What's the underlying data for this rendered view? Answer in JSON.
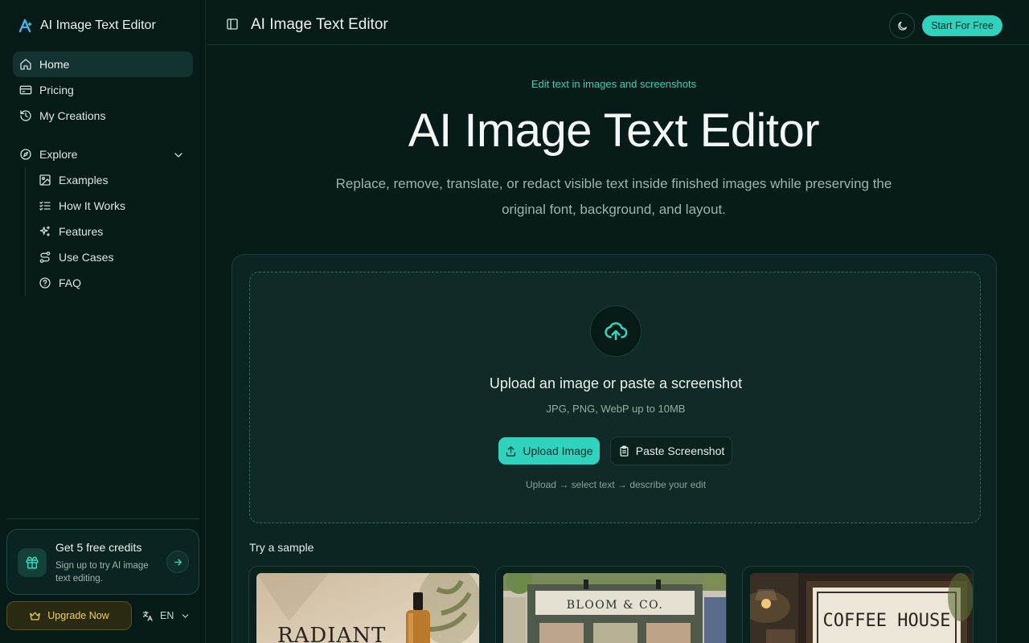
{
  "app": {
    "name": "AI Image Text Editor"
  },
  "sidebar": {
    "nav": [
      {
        "label": "Home",
        "icon": "home-icon",
        "active": true
      },
      {
        "label": "Pricing",
        "icon": "credit-card-icon"
      },
      {
        "label": "My Creations",
        "icon": "history-icon"
      }
    ],
    "explore": {
      "label": "Explore",
      "icon": "compass-icon",
      "items": [
        {
          "label": "Examples",
          "icon": "image-icon"
        },
        {
          "label": "How It Works",
          "icon": "list-checks-icon"
        },
        {
          "label": "Features",
          "icon": "sparkles-icon"
        },
        {
          "label": "Use Cases",
          "icon": "route-icon"
        },
        {
          "label": "FAQ",
          "icon": "help-circle-icon"
        }
      ]
    },
    "credits": {
      "title": "Get 5 free credits",
      "subtitle": "Sign up to try AI image text editing."
    },
    "upgrade_label": "Upgrade Now",
    "language": "EN"
  },
  "header": {
    "title": "AI Image Text Editor",
    "cta_label": "Start For Free"
  },
  "hero": {
    "eyebrow": "Edit text in images and screenshots",
    "title": "AI Image Text Editor",
    "subtitle": "Replace, remove, translate, or redact visible text inside finished images while preserving the original font, background, and layout."
  },
  "upload": {
    "title": "Upload an image or paste a screenshot",
    "formats": "JPG, PNG, WebP up to 10MB",
    "upload_label": "Upload Image",
    "paste_label": "Paste Screenshot",
    "hint": "Upload → select text → describe your edit"
  },
  "samples": {
    "label": "Try a sample",
    "items": [
      {
        "text": "RADIANT"
      },
      {
        "text": "BLOOM & CO."
      },
      {
        "text": "COFFEE HOUSE"
      }
    ]
  },
  "colors": {
    "accent": "#2fd3bd",
    "background": "#071c19",
    "upgrade_gold": "#f2cf4a"
  }
}
